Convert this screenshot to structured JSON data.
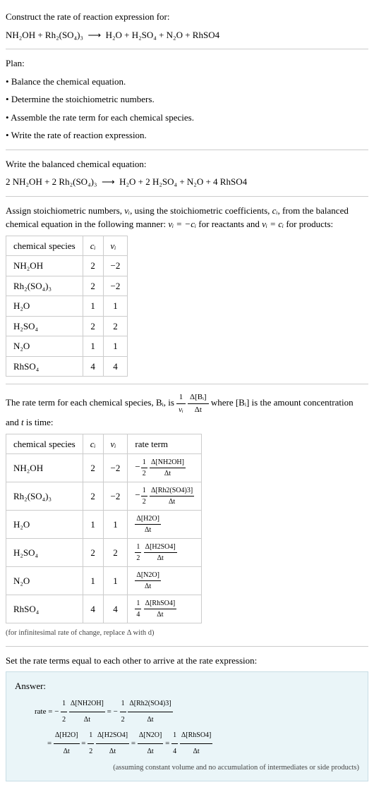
{
  "intro": {
    "prompt": "Construct the rate of reaction expression for:",
    "equation_lhs": "NH₂OH + Rh₂(SO₄)₃",
    "arrow": "⟶",
    "equation_rhs": "H₂O + H₂SO₄ + N₂O + RhSO4"
  },
  "plan": {
    "heading": "Plan:",
    "items": [
      "Balance the chemical equation.",
      "Determine the stoichiometric numbers.",
      "Assemble the rate term for each chemical species.",
      "Write the rate of reaction expression."
    ]
  },
  "balanced": {
    "prompt": "Write the balanced chemical equation:",
    "equation_lhs": "2 NH₂OH + 2 Rh₂(SO₄)₃",
    "arrow": "⟶",
    "equation_rhs": "H₂O + 2 H₂SO₄ + N₂O + 4 RhSO4"
  },
  "assign": {
    "text_a": "Assign stoichiometric numbers, ",
    "nu_i": "νᵢ",
    "text_b": ", using the stoichiometric coefficients, ",
    "c_i": "cᵢ",
    "text_c": ", from the balanced chemical equation in the following manner: ",
    "rel1": "νᵢ = −cᵢ",
    "text_d": " for reactants and ",
    "rel2": "νᵢ = cᵢ",
    "text_e": " for products:"
  },
  "table1": {
    "headers": [
      "chemical species",
      "cᵢ",
      "νᵢ"
    ],
    "rows": [
      {
        "species": "NH₂OH",
        "c": "2",
        "nu": "−2"
      },
      {
        "species": "Rh₂(SO₄)₃",
        "c": "2",
        "nu": "−2"
      },
      {
        "species": "H₂O",
        "c": "1",
        "nu": "1"
      },
      {
        "species": "H₂SO₄",
        "c": "2",
        "nu": "2"
      },
      {
        "species": "N₂O",
        "c": "1",
        "nu": "1"
      },
      {
        "species": "RhSO₄",
        "c": "4",
        "nu": "4"
      }
    ]
  },
  "rate_term_intro": {
    "text_a": "The rate term for each chemical species, Bᵢ, is ",
    "one": "1",
    "nu_i": "νᵢ",
    "dBi": "Δ[Bᵢ]",
    "dt": "Δt",
    "text_b": " where [Bᵢ] is the amount concentration and ",
    "t_var": "t",
    "text_c": " is time:"
  },
  "table2": {
    "headers": [
      "chemical species",
      "cᵢ",
      "νᵢ",
      "rate term"
    ],
    "rows": [
      {
        "species": "NH₂OH",
        "c": "2",
        "nu": "−2",
        "coef_num": "1",
        "coef_den": "2",
        "neg": true,
        "conc": "Δ[NH2OH]",
        "dt": "Δt"
      },
      {
        "species": "Rh₂(SO₄)₃",
        "c": "2",
        "nu": "−2",
        "coef_num": "1",
        "coef_den": "2",
        "neg": true,
        "conc": "Δ[Rh2(SO4)3]",
        "dt": "Δt"
      },
      {
        "species": "H₂O",
        "c": "1",
        "nu": "1",
        "coef_num": "",
        "coef_den": "",
        "neg": false,
        "conc": "Δ[H2O]",
        "dt": "Δt"
      },
      {
        "species": "H₂SO₄",
        "c": "2",
        "nu": "2",
        "coef_num": "1",
        "coef_den": "2",
        "neg": false,
        "conc": "Δ[H2SO4]",
        "dt": "Δt"
      },
      {
        "species": "N₂O",
        "c": "1",
        "nu": "1",
        "coef_num": "",
        "coef_den": "",
        "neg": false,
        "conc": "Δ[N2O]",
        "dt": "Δt"
      },
      {
        "species": "RhSO₄",
        "c": "4",
        "nu": "4",
        "coef_num": "1",
        "coef_den": "4",
        "neg": false,
        "conc": "Δ[RhSO4]",
        "dt": "Δt"
      }
    ],
    "footnote": "(for infinitesimal rate of change, replace Δ with d)"
  },
  "final": {
    "prompt": "Set the rate terms equal to each other to arrive at the rate expression:",
    "answer_label": "Answer:",
    "rate_word": "rate = ",
    "eq": " = ",
    "neg": "−",
    "half_num": "1",
    "half_den": "2",
    "quarter_num": "1",
    "quarter_den": "4",
    "c1": "Δ[NH2OH]",
    "c2": "Δ[Rh2(SO4)3]",
    "c3": "Δ[H2O]",
    "c4": "Δ[H2SO4]",
    "c5": "Δ[N2O]",
    "c6": "Δ[RhSO4]",
    "dt": "Δt",
    "assumption": "(assuming constant volume and no accumulation of intermediates or side products)"
  }
}
